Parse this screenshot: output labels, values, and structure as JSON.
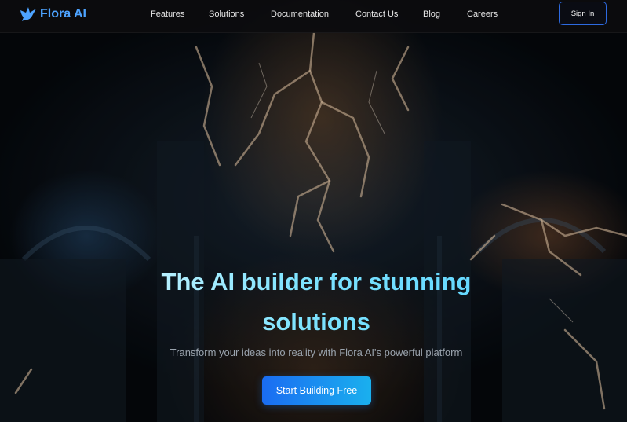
{
  "brand": {
    "name": "Flora AI",
    "icon": "bird-icon",
    "accent": "#4da3ff"
  },
  "nav": {
    "links": [
      "Features",
      "Solutions",
      "Documentation",
      "Contact Us",
      "Blog",
      "Careers"
    ],
    "sign_in_label": "Sign In"
  },
  "hero": {
    "headline_line1": "The AI builder for stunning",
    "headline_line2": "solutions",
    "subtitle": "Transform your ideas into reality with Flora AI's powerful platform",
    "cta_label": "Start Building Free",
    "background": "lightning-machine-scene"
  },
  "colors": {
    "cta_start": "#1a6cf2",
    "cta_end": "#1ab0ee",
    "headline": "#7fe4ff",
    "sign_in_border": "#2d6ae0"
  }
}
